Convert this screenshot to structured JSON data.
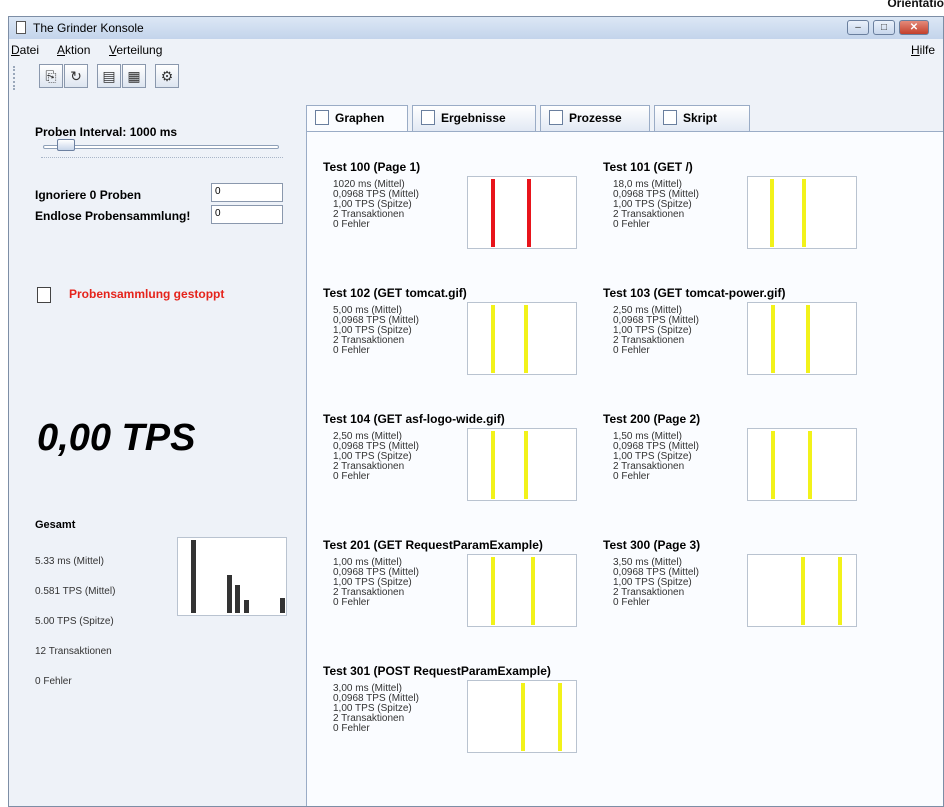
{
  "corner_text": "Orientatio",
  "window": {
    "title": "The Grinder Konsole"
  },
  "menu": {
    "datei": "Datei",
    "aktion": "Aktion",
    "verteilung": "Verteilung",
    "hilfe": "Hilfe"
  },
  "left": {
    "interval_label": "Proben Interval: 1000 ms",
    "interval_fraction": 0.06,
    "ignore_label": "Ignoriere 0 Proben",
    "ignore_value": "0",
    "endless_label": "Endlose Probensammlung!",
    "endless_value": "0",
    "status": "Probensammlung gestoppt",
    "tps": "0,00 TPS",
    "total": {
      "title": "Gesamt",
      "mean": "5.33 ms (Mittel)",
      "tps_mean": "0.581 TPS (Mittel)",
      "tps_peak": "5.00 TPS (Spitze)",
      "transactions": "12 Transaktionen",
      "errors": "0 Fehler",
      "bars": [
        0,
        1.0,
        0,
        0,
        0,
        0.52,
        0.38,
        0.18,
        0,
        0,
        0,
        0.2
      ]
    }
  },
  "tabs": [
    {
      "label": "Graphen",
      "icon": "graph-icon"
    },
    {
      "label": "Ergebnisse",
      "icon": "document-icon"
    },
    {
      "label": "Prozesse",
      "icon": "process-icon"
    },
    {
      "label": "Skript",
      "icon": "script-icon"
    }
  ],
  "tests": [
    {
      "title": "Test 100 (Page 1)",
      "mean": "1020 ms (Mittel)",
      "tps_mean": "0,0968 TPS (Mittel)",
      "tps_peak": "1,00 TPS (Spitze)",
      "transactions": "2 Transaktionen",
      "errors": "0 Fehler",
      "color": "#e8141b",
      "bars": [
        0.22,
        0.56
      ]
    },
    {
      "title": "Test 101 (GET /)",
      "mean": "18,0 ms (Mittel)",
      "tps_mean": "0,0968 TPS (Mittel)",
      "tps_peak": "1,00 TPS (Spitze)",
      "transactions": "2 Transaktionen",
      "errors": "0 Fehler",
      "color": "#f2f21a",
      "bars": [
        0.21,
        0.51
      ]
    },
    {
      "title": "Test 102 (GET tomcat.gif)",
      "mean": "5,00 ms (Mittel)",
      "tps_mean": "0,0968 TPS (Mittel)",
      "tps_peak": "1,00 TPS (Spitze)",
      "transactions": "2 Transaktionen",
      "errors": "0 Fehler",
      "color": "#f2f21a",
      "bars": [
        0.22,
        0.53
      ]
    },
    {
      "title": "Test 103 (GET tomcat-power.gif)",
      "mean": "2,50 ms (Mittel)",
      "tps_mean": "0,0968 TPS (Mittel)",
      "tps_peak": "1,00 TPS (Spitze)",
      "transactions": "2 Transaktionen",
      "errors": "0 Fehler",
      "color": "#f2f21a",
      "bars": [
        0.22,
        0.55
      ]
    },
    {
      "title": "Test 104 (GET asf-logo-wide.gif)",
      "mean": "2,50 ms (Mittel)",
      "tps_mean": "0,0968 TPS (Mittel)",
      "tps_peak": "1,00 TPS (Spitze)",
      "transactions": "2 Transaktionen",
      "errors": "0 Fehler",
      "color": "#f2f21a",
      "bars": [
        0.22,
        0.53
      ]
    },
    {
      "title": "Test 200 (Page 2)",
      "mean": "1,50 ms (Mittel)",
      "tps_mean": "0,0968 TPS (Mittel)",
      "tps_peak": "1,00 TPS (Spitze)",
      "transactions": "2 Transaktionen",
      "errors": "0 Fehler",
      "color": "#f2f21a",
      "bars": [
        0.22,
        0.57
      ]
    },
    {
      "title": "Test 201 (GET RequestParamExample)",
      "mean": "1,00 ms (Mittel)",
      "tps_mean": "0,0968 TPS (Mittel)",
      "tps_peak": "1,00 TPS (Spitze)",
      "transactions": "2 Transaktionen",
      "errors": "0 Fehler",
      "color": "#f2f21a",
      "bars": [
        0.22,
        0.59
      ]
    },
    {
      "title": "Test 300 (Page 3)",
      "mean": "3,50 ms (Mittel)",
      "tps_mean": "0,0968 TPS (Mittel)",
      "tps_peak": "1,00 TPS (Spitze)",
      "transactions": "2 Transaktionen",
      "errors": "0 Fehler",
      "color": "#f2f21a",
      "bars": [
        0.5,
        0.85
      ]
    },
    {
      "title": "Test 301 (POST RequestParamExample)",
      "mean": "3,00 ms (Mittel)",
      "tps_mean": "0,0968 TPS (Mittel)",
      "tps_peak": "1,00 TPS (Spitze)",
      "transactions": "2 Transaktionen",
      "errors": "0 Fehler",
      "color": "#f2f21a",
      "bars": [
        0.5,
        0.85
      ]
    }
  ]
}
